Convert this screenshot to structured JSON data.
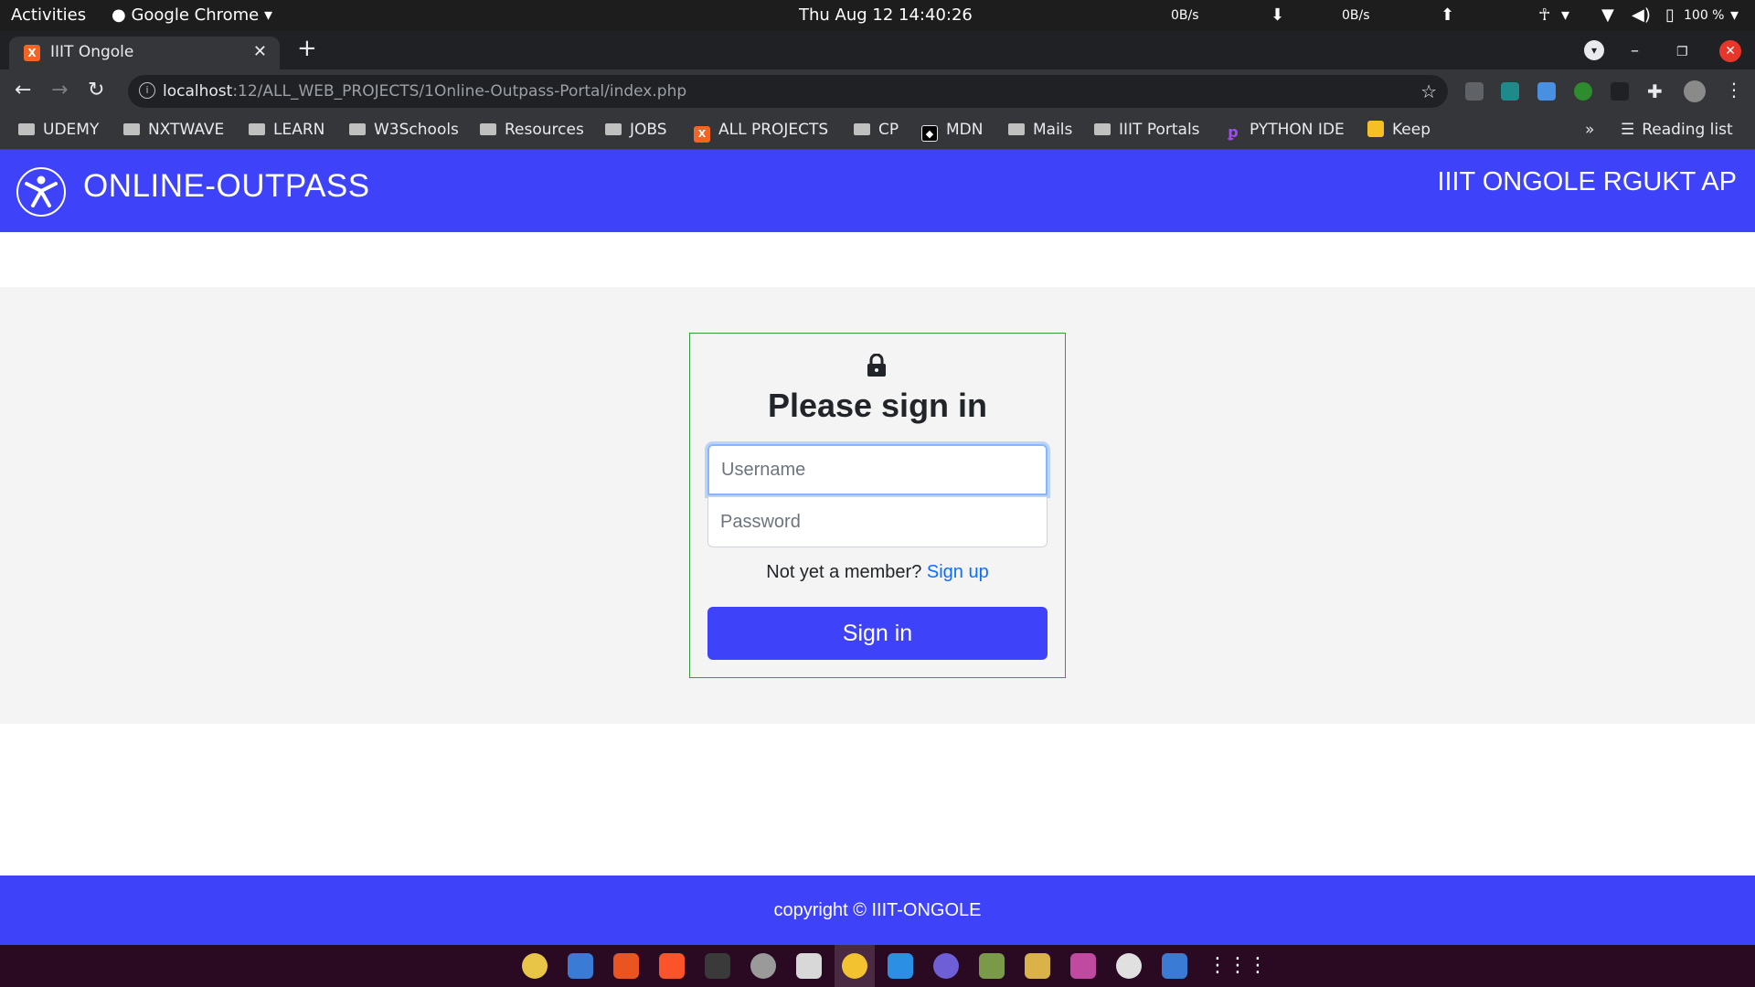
{
  "system_bar": {
    "activities": "Activities",
    "app_name": "Google Chrome",
    "datetime": "Thu Aug 12  14:40:26",
    "net_down": "0B/s",
    "net_up": "0B/s",
    "battery": "100 %"
  },
  "browser": {
    "tab_title": "IIIT Ongole",
    "tab_favicon": "X",
    "url_host": "localhost",
    "url_path": ":12/ALL_WEB_PROJECTS/1Online-Outpass-Portal/index.php",
    "bookmarks": [
      {
        "label": "UDEMY",
        "type": "folder"
      },
      {
        "label": "NXTWAVE",
        "type": "folder"
      },
      {
        "label": "LEARN",
        "type": "folder"
      },
      {
        "label": "W3Schools",
        "type": "folder"
      },
      {
        "label": "Resources",
        "type": "folder"
      },
      {
        "label": "JOBS",
        "type": "folder"
      },
      {
        "label": "ALL PROJECTS",
        "type": "site"
      },
      {
        "label": "CP",
        "type": "folder"
      },
      {
        "label": "MDN",
        "type": "site"
      },
      {
        "label": "Mails",
        "type": "folder"
      },
      {
        "label": "IIIT Portals",
        "type": "folder"
      },
      {
        "label": "PYTHON IDE",
        "type": "site"
      },
      {
        "label": "Keep",
        "type": "site"
      }
    ],
    "bookmarks_overflow": "»",
    "reading_list": "Reading list"
  },
  "header": {
    "brand": "ONLINE-OUTPASS",
    "institute": "IIIT ONGOLE RGUKT AP"
  },
  "login": {
    "title": "Please sign in",
    "username_placeholder": "Username",
    "password_placeholder": "Password",
    "member_prompt": "Not yet a member?",
    "signup_link": "Sign up",
    "signin_button": "Sign in"
  },
  "footer": {
    "copyright": "copyright © IIIT-ONGOLE"
  },
  "colors": {
    "brand_blue": "#3e43fa",
    "card_border": "#2e9e3e",
    "link_blue": "#0d6efd"
  }
}
